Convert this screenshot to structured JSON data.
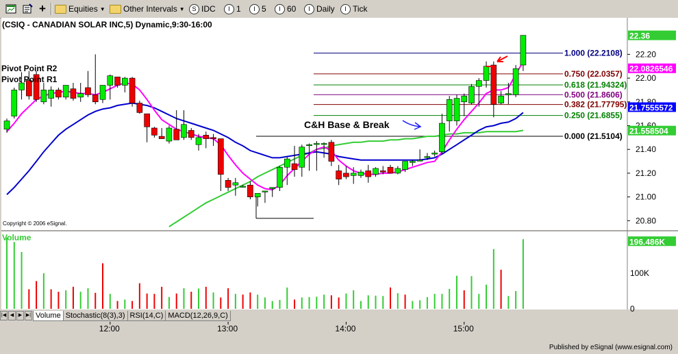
{
  "toolbar": {
    "symbol_group": "Equities",
    "interval_group": "Other Intervals",
    "buttons": [
      {
        "label": "IDC",
        "glyph": "S"
      },
      {
        "label": "1",
        "glyph": "I"
      },
      {
        "label": "5",
        "glyph": "I"
      },
      {
        "label": "60",
        "glyph": "I"
      },
      {
        "label": "Daily",
        "glyph": "I"
      },
      {
        "label": "Tick",
        "glyph": "I"
      }
    ]
  },
  "chart_title": "(CSIQ - CANADIAN SOLAR INC,5) Dynamic,9:30-16:00",
  "copyright": "Copyright © 2006 eSignal.",
  "published": "Published by eSignal (www.esignal.com)",
  "pivot_labels": [
    "Pivot Point R2",
    "Pivot Point R1"
  ],
  "annotation": "C&H Base & Break",
  "volume_label": "Volume",
  "tabs": [
    "Volume",
    "Stochastic(8(3),3)",
    "RSI(14,C)",
    "MACD(12,26,9,C)"
  ],
  "chart_data": {
    "type": "candlestick",
    "price_axis": {
      "min": 20.75,
      "max": 22.45,
      "ticks": [
        "22.20",
        "22.00",
        "21.80",
        "21.60",
        "21.40",
        "21.20",
        "21.00",
        "20.80"
      ],
      "tick_values": [
        22.2,
        22.0,
        21.8,
        21.6,
        21.4,
        21.2,
        21.0,
        20.8
      ]
    },
    "time_axis": {
      "labels": [
        "12:00",
        "13:00",
        "14:00",
        "15:00"
      ],
      "label_bar_index": [
        14,
        30,
        46,
        62
      ]
    },
    "candles": [
      {
        "o": 21.57,
        "h": 21.66,
        "l": 21.54,
        "c": 21.64
      },
      {
        "o": 21.68,
        "h": 21.92,
        "l": 21.66,
        "c": 21.9
      },
      {
        "o": 21.9,
        "h": 22.05,
        "l": 21.82,
        "c": 21.96
      },
      {
        "o": 21.98,
        "h": 22.06,
        "l": 21.82,
        "c": 21.85
      },
      {
        "o": 22.03,
        "h": 22.06,
        "l": 21.8,
        "c": 21.82
      },
      {
        "o": 21.8,
        "h": 21.96,
        "l": 21.78,
        "c": 21.9
      },
      {
        "o": 21.83,
        "h": 21.93,
        "l": 21.76,
        "c": 21.9
      },
      {
        "o": 21.9,
        "h": 21.92,
        "l": 21.82,
        "c": 21.84
      },
      {
        "o": 21.84,
        "h": 21.94,
        "l": 21.82,
        "c": 21.94
      },
      {
        "o": 21.91,
        "h": 21.96,
        "l": 21.81,
        "c": 21.83
      },
      {
        "o": 21.84,
        "h": 21.96,
        "l": 21.8,
        "c": 21.87
      },
      {
        "o": 21.92,
        "h": 22.06,
        "l": 21.84,
        "c": 21.86
      },
      {
        "o": 21.86,
        "h": 22.2,
        "l": 21.78,
        "c": 21.8
      },
      {
        "o": 21.82,
        "h": 21.94,
        "l": 21.79,
        "c": 21.94
      },
      {
        "o": 21.94,
        "h": 22.03,
        "l": 21.82,
        "c": 22.02
      },
      {
        "o": 22.01,
        "h": 22.01,
        "l": 21.92,
        "c": 21.94
      },
      {
        "o": 21.94,
        "h": 22.01,
        "l": 21.88,
        "c": 22.0
      },
      {
        "o": 22.0,
        "h": 22.01,
        "l": 21.76,
        "c": 21.79
      },
      {
        "o": 21.79,
        "h": 21.81,
        "l": 21.7,
        "c": 21.71
      },
      {
        "o": 21.7,
        "h": 21.7,
        "l": 21.46,
        "c": 21.59
      },
      {
        "o": 21.58,
        "h": 21.59,
        "l": 21.5,
        "c": 21.52
      },
      {
        "o": 21.51,
        "h": 21.58,
        "l": 21.49,
        "c": 21.49
      },
      {
        "o": 21.47,
        "h": 21.6,
        "l": 21.45,
        "c": 21.58
      },
      {
        "o": 21.57,
        "h": 21.73,
        "l": 21.49,
        "c": 21.48
      },
      {
        "o": 21.5,
        "h": 21.73,
        "l": 21.48,
        "c": 21.61
      },
      {
        "o": 21.56,
        "h": 21.58,
        "l": 21.48,
        "c": 21.5
      },
      {
        "o": 21.44,
        "h": 21.53,
        "l": 21.39,
        "c": 21.5
      },
      {
        "o": 21.52,
        "h": 21.55,
        "l": 21.41,
        "c": 21.49
      },
      {
        "o": 21.5,
        "h": 21.53,
        "l": 21.43,
        "c": 21.49
      },
      {
        "o": 21.49,
        "h": 21.49,
        "l": 21.05,
        "c": 21.19
      },
      {
        "o": 21.14,
        "h": 21.16,
        "l": 21.05,
        "c": 21.08
      },
      {
        "o": 21.1,
        "h": 21.16,
        "l": 21.01,
        "c": 21.12
      },
      {
        "o": 21.09,
        "h": 21.1,
        "l": 21.08,
        "c": 21.09
      },
      {
        "o": 21.1,
        "h": 21.13,
        "l": 20.98,
        "c": 21.0
      },
      {
        "o": 21.0,
        "h": 21.03,
        "l": 20.92,
        "c": 21.03
      },
      {
        "o": 21.05,
        "h": 21.05,
        "l": 20.95,
        "c": 21.05
      },
      {
        "o": 21.07,
        "h": 21.08,
        "l": 21.0,
        "c": 21.08
      },
      {
        "o": 21.08,
        "h": 21.26,
        "l": 21.05,
        "c": 21.25
      },
      {
        "o": 21.25,
        "h": 21.34,
        "l": 21.1,
        "c": 21.32
      },
      {
        "o": 21.28,
        "h": 21.43,
        "l": 21.17,
        "c": 21.23
      },
      {
        "o": 21.25,
        "h": 21.44,
        "l": 21.17,
        "c": 21.42
      },
      {
        "o": 21.44,
        "h": 21.45,
        "l": 21.22,
        "c": 21.44
      },
      {
        "o": 21.45,
        "h": 21.47,
        "l": 21.22,
        "c": 21.45
      },
      {
        "o": 21.45,
        "h": 21.46,
        "l": 21.33,
        "c": 21.45
      },
      {
        "o": 21.46,
        "h": 21.48,
        "l": 21.26,
        "c": 21.3
      },
      {
        "o": 21.22,
        "h": 21.27,
        "l": 21.1,
        "c": 21.15
      },
      {
        "o": 21.2,
        "h": 21.26,
        "l": 21.15,
        "c": 21.17
      },
      {
        "o": 21.18,
        "h": 21.25,
        "l": 21.11,
        "c": 21.2
      },
      {
        "o": 21.18,
        "h": 21.23,
        "l": 21.16,
        "c": 21.21
      },
      {
        "o": 21.22,
        "h": 21.27,
        "l": 21.12,
        "c": 21.17
      },
      {
        "o": 21.19,
        "h": 21.25,
        "l": 21.17,
        "c": 21.24
      },
      {
        "o": 21.22,
        "h": 21.26,
        "l": 21.19,
        "c": 21.21
      },
      {
        "o": 21.25,
        "h": 21.27,
        "l": 21.2,
        "c": 21.2
      },
      {
        "o": 21.2,
        "h": 21.26,
        "l": 21.19,
        "c": 21.24
      },
      {
        "o": 21.23,
        "h": 21.3,
        "l": 21.21,
        "c": 21.3
      },
      {
        "o": 21.29,
        "h": 21.31,
        "l": 21.26,
        "c": 21.3
      },
      {
        "o": 21.31,
        "h": 21.4,
        "l": 21.3,
        "c": 21.31
      },
      {
        "o": 21.34,
        "h": 21.37,
        "l": 21.31,
        "c": 21.34
      },
      {
        "o": 21.36,
        "h": 21.39,
        "l": 21.34,
        "c": 21.37
      },
      {
        "o": 21.38,
        "h": 21.7,
        "l": 21.36,
        "c": 21.62
      },
      {
        "o": 21.64,
        "h": 21.85,
        "l": 21.55,
        "c": 21.82
      },
      {
        "o": 21.64,
        "h": 21.86,
        "l": 21.6,
        "c": 21.83
      },
      {
        "o": 21.8,
        "h": 21.87,
        "l": 21.68,
        "c": 21.85
      },
      {
        "o": 21.79,
        "h": 21.95,
        "l": 21.78,
        "c": 21.93
      },
      {
        "o": 21.93,
        "h": 22.0,
        "l": 21.76,
        "c": 21.98
      },
      {
        "o": 21.98,
        "h": 22.14,
        "l": 21.92,
        "c": 22.1
      },
      {
        "o": 22.11,
        "h": 22.14,
        "l": 21.67,
        "c": 21.78
      },
      {
        "o": 21.79,
        "h": 21.89,
        "l": 21.78,
        "c": 21.85
      },
      {
        "o": 21.86,
        "h": 21.96,
        "l": 21.78,
        "c": 21.87
      },
      {
        "o": 21.86,
        "h": 22.11,
        "l": 21.84,
        "c": 22.08
      },
      {
        "o": 22.11,
        "h": 22.36,
        "l": 22.06,
        "c": 22.36
      }
    ],
    "ma_fast": [
      21.55,
      21.62,
      21.7,
      21.76,
      21.82,
      21.85,
      21.87,
      21.88,
      21.89,
      21.88,
      21.87,
      21.87,
      21.86,
      21.88,
      21.91,
      21.94,
      21.96,
      21.95,
      21.9,
      21.82,
      21.73,
      21.65,
      21.61,
      21.57,
      21.55,
      21.53,
      21.51,
      21.5,
      21.49,
      21.44,
      21.35,
      21.27,
      21.2,
      21.15,
      21.1,
      21.07,
      21.06,
      21.1,
      21.18,
      21.24,
      21.3,
      21.36,
      21.4,
      21.42,
      21.39,
      21.31,
      21.26,
      21.22,
      21.2,
      21.19,
      21.19,
      21.2,
      21.2,
      21.21,
      21.23,
      21.25,
      21.27,
      21.29,
      21.3,
      21.38,
      21.48,
      21.57,
      21.65,
      21.72,
      21.79,
      21.87,
      21.9,
      21.9,
      21.92,
      22.03,
      22.14
    ],
    "ma_mid": [
      21.02,
      21.08,
      21.15,
      21.22,
      21.3,
      21.38,
      21.45,
      21.52,
      21.57,
      21.61,
      21.65,
      21.69,
      21.72,
      21.74,
      21.75,
      21.77,
      21.78,
      21.79,
      21.78,
      21.77,
      21.75,
      21.72,
      21.69,
      21.66,
      21.64,
      21.62,
      21.6,
      21.58,
      21.56,
      21.53,
      21.5,
      21.46,
      21.43,
      21.39,
      21.37,
      21.35,
      21.33,
      21.33,
      21.34,
      21.35,
      21.36,
      21.37,
      21.38,
      21.37,
      21.36,
      21.34,
      21.33,
      21.32,
      21.31,
      21.31,
      21.31,
      21.31,
      21.31,
      21.31,
      21.31,
      21.31,
      21.31,
      21.32,
      21.33,
      21.36,
      21.4,
      21.44,
      21.48,
      21.52,
      21.56,
      21.59,
      21.6,
      21.62,
      21.63,
      21.66,
      21.71
    ],
    "ma_slow_start_index": 22,
    "ma_slow": [
      20.75,
      20.79,
      20.83,
      20.87,
      20.91,
      20.95,
      20.98,
      21.01,
      21.04,
      21.07,
      21.1,
      21.13,
      21.17,
      21.2,
      21.23,
      21.26,
      21.29,
      21.32,
      21.35,
      21.37,
      21.4,
      21.41,
      21.43,
      21.44,
      21.45,
      21.46,
      21.46,
      21.47,
      21.47,
      21.47,
      21.48,
      21.48,
      21.49,
      21.49,
      21.5,
      21.51,
      21.51,
      21.52,
      21.53,
      21.53,
      21.54,
      21.54,
      21.54,
      21.55,
      21.55,
      21.55,
      21.55,
      21.55,
      21.56
    ],
    "fib_levels": [
      {
        "ratio": "1.000",
        "price": 22.2108,
        "label": "1.000 (22.2108)",
        "color": "#000080"
      },
      {
        "ratio": "0.750",
        "price": 22.0357,
        "label": "0.750 (22.0357)",
        "color": "#800000"
      },
      {
        "ratio": "0.618",
        "price": 21.94324,
        "label": "0.618 (21.94324)",
        "color": "#008000"
      },
      {
        "ratio": "0.500",
        "price": 21.8606,
        "label": "0.500 (21.8606)",
        "color": "#800080"
      },
      {
        "ratio": "0.382",
        "price": 21.77795,
        "label": "0.382 (21.77795)",
        "color": "#800000"
      },
      {
        "ratio": "0.250",
        "price": 21.6855,
        "label": "0.250 (21.6855)",
        "color": "#008000"
      },
      {
        "ratio": "0.000",
        "price": 21.5104,
        "label": "0.000 (21.5104)",
        "color": "#000000"
      }
    ],
    "right_price_tags": [
      {
        "text": "22.36",
        "value": 22.36,
        "bg": "#33cc33",
        "fg": "#ffffff"
      },
      {
        "text": "22.0826546",
        "value": 22.0826546,
        "bg": "#ff00ff",
        "fg": "#ffffff"
      },
      {
        "text": "21.7555572",
        "value": 21.7555572,
        "bg": "#0000ff",
        "fg": "#ffffff"
      },
      {
        "text": "21.558504",
        "value": 21.558504,
        "bg": "#33cc33",
        "fg": "#ffffff"
      }
    ],
    "volume": {
      "max": 210,
      "ticks": [
        "100K",
        "0"
      ],
      "tick_values": [
        100,
        0
      ],
      "last_tag": "196.486K",
      "values": [
        200,
        188,
        160,
        55,
        78,
        100,
        55,
        48,
        52,
        62,
        48,
        58,
        45,
        128,
        42,
        22,
        26,
        22,
        72,
        43,
        42,
        62,
        33,
        43,
        58,
        48,
        57,
        62,
        46,
        32,
        58,
        42,
        40,
        46,
        40,
        32,
        22,
        25,
        60,
        26,
        32,
        33,
        34,
        40,
        38,
        32,
        43,
        52,
        22,
        38,
        37,
        36,
        60,
        44,
        40,
        22,
        24,
        33,
        42,
        42,
        56,
        93,
        52,
        92,
        42,
        68,
        168,
        110,
        36,
        50,
        196
      ],
      "colors": [
        "g",
        "g",
        "g",
        "r",
        "r",
        "g",
        "r",
        "r",
        "g",
        "r",
        "g",
        "g",
        "r",
        "r",
        "g",
        "r",
        "g",
        "r",
        "r",
        "r",
        "r",
        "r",
        "g",
        "r",
        "g",
        "r",
        "g",
        "r",
        "g",
        "r",
        "r",
        "g",
        "r",
        "r",
        "g",
        "g",
        "g",
        "g",
        "g",
        "r",
        "g",
        "g",
        "g",
        "g",
        "r",
        "r",
        "g",
        "g",
        "g",
        "g",
        "g",
        "g",
        "r",
        "g",
        "r",
        "g",
        "g",
        "g",
        "g",
        "g",
        "g",
        "g",
        "r",
        "g",
        "g",
        "g",
        "g",
        "r",
        "g",
        "g",
        "g"
      ]
    }
  }
}
